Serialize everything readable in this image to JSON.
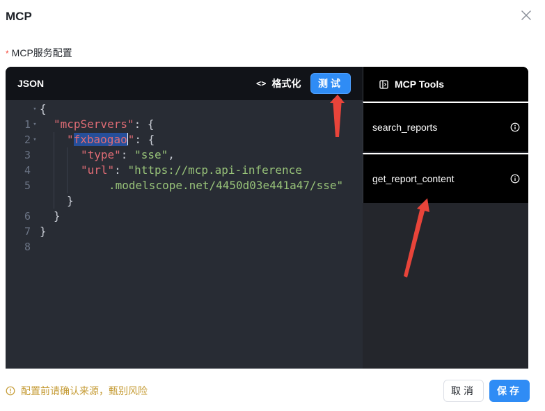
{
  "dialog": {
    "title": "MCP",
    "close_icon": "close-icon"
  },
  "field": {
    "required_mark": "*",
    "label": "MCP服务配置"
  },
  "editor": {
    "tab_label": "JSON",
    "format_icon": "<>",
    "format_label": "格式化",
    "test_label": "测试",
    "line_numbers": [
      "1",
      "2",
      "3",
      "4",
      "5",
      "",
      "6",
      "7",
      "8"
    ],
    "tokens": {
      "open_brace": "{",
      "mcp_servers_key": "\"mcpServers\"",
      "colon_brace": ": {",
      "quote_open": "\"",
      "server_name": "fxbaogao",
      "quote_close": "\"",
      "colon_brace_2": ": {",
      "type_key": "\"type\"",
      "colon_sp": ": ",
      "type_value": "\"sse\"",
      "comma": ",",
      "url_key": "\"url\"",
      "colon_sp_2": ": ",
      "url_value_part1": "\"https://mcp.api-inference",
      "url_value_part2": ".modelscope.net/4450d03e441a47/sse\"",
      "close_brace_inner": "}",
      "close_brace_mid": "}",
      "close_brace_outer": "}"
    }
  },
  "tools_panel": {
    "icon": "panel-icon",
    "title": "MCP Tools",
    "items": [
      {
        "name": "search_reports",
        "icon": "info-icon"
      },
      {
        "name": "get_report_content",
        "icon": "info-icon"
      }
    ]
  },
  "footer": {
    "warning": "配置前请确认来源，甄别风险",
    "cancel_label": "取消",
    "save_label": "保存"
  },
  "colors": {
    "primary": "#2f8cf5",
    "warning": "#c59b34",
    "annotation_arrow": "#e8443a",
    "editor_bg": "#282c34"
  }
}
